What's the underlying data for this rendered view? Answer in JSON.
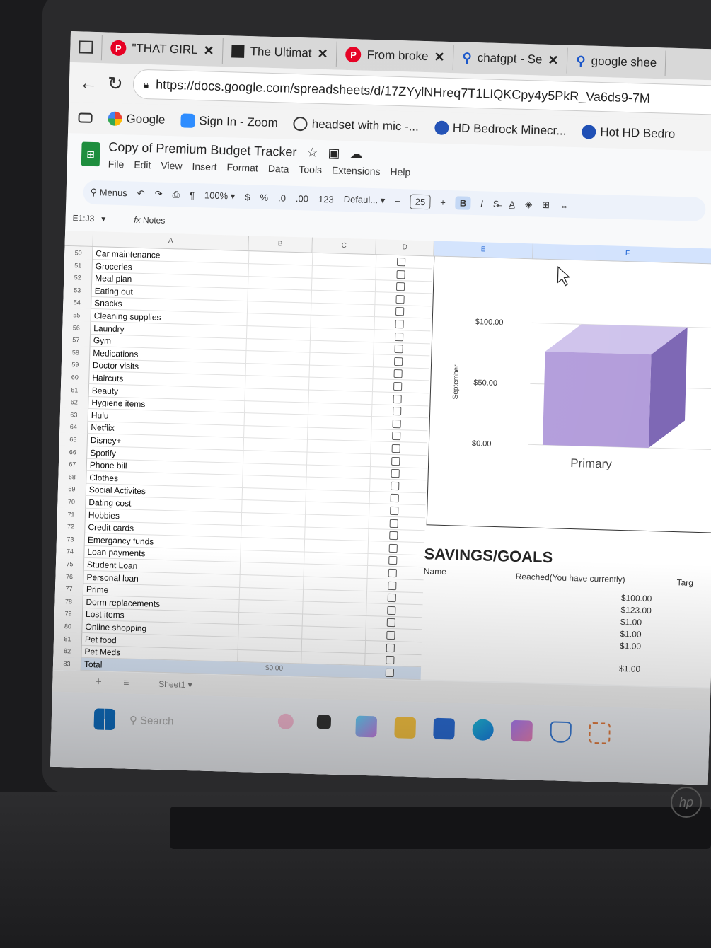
{
  "browser": {
    "tabs": [
      {
        "label": "\"THAT GIRL",
        "icon": "pinterest-icon"
      },
      {
        "label": "The Ultimat",
        "icon": "notion-icon"
      },
      {
        "label": "From broke",
        "icon": "pinterest-icon"
      },
      {
        "label": "chatgpt - Se",
        "icon": "search-icon"
      },
      {
        "label": "google shee",
        "icon": "search-icon"
      }
    ],
    "url": "https://docs.google.com/spreadsheets/d/17ZYylNHreq7T1LIQKCpy4y5PkR_Va6ds9-7M",
    "bookmarks": [
      "Google",
      "Sign In - Zoom",
      "headset with mic -...",
      "HD Bedrock Minecr...",
      "Hot HD Bedro"
    ]
  },
  "doc": {
    "title": "Copy of Premium Budget Tracker",
    "menu": [
      "File",
      "Edit",
      "View",
      "Insert",
      "Format",
      "Data",
      "Tools",
      "Extensions",
      "Help"
    ],
    "toolbar": {
      "menus": "Menus",
      "zoom": "100%",
      "currency": "$",
      "percent": "%",
      "dec_less": ".0",
      "dec_more": ".00",
      "num_format": "123",
      "font": "Defaul...",
      "font_size": "25",
      "bold": "B",
      "italic": "I"
    },
    "cell_ref": "E1:J3",
    "formula": "Notes"
  },
  "grid": {
    "columns": [
      "A",
      "B",
      "C",
      "D",
      "E",
      "F"
    ],
    "rows": [
      {
        "n": "50",
        "a": "Car maintenance"
      },
      {
        "n": "51",
        "a": "Groceries"
      },
      {
        "n": "52",
        "a": "Meal plan"
      },
      {
        "n": "53",
        "a": "Eating out"
      },
      {
        "n": "54",
        "a": "Snacks"
      },
      {
        "n": "55",
        "a": "Cleaning supplies"
      },
      {
        "n": "56",
        "a": "Laundry"
      },
      {
        "n": "57",
        "a": "Gym"
      },
      {
        "n": "58",
        "a": "Medications"
      },
      {
        "n": "59",
        "a": "Doctor visits"
      },
      {
        "n": "60",
        "a": "Haircuts"
      },
      {
        "n": "61",
        "a": "Beauty"
      },
      {
        "n": "62",
        "a": "Hygiene items"
      },
      {
        "n": "63",
        "a": "Hulu"
      },
      {
        "n": "64",
        "a": "Netflix"
      },
      {
        "n": "65",
        "a": "Disney+"
      },
      {
        "n": "66",
        "a": "Spotify"
      },
      {
        "n": "67",
        "a": "Phone bill"
      },
      {
        "n": "68",
        "a": "Clothes"
      },
      {
        "n": "69",
        "a": "Social Activites"
      },
      {
        "n": "70",
        "a": "Dating cost"
      },
      {
        "n": "71",
        "a": "Hobbies"
      },
      {
        "n": "72",
        "a": "Credit cards"
      },
      {
        "n": "73",
        "a": "Emergancy funds"
      },
      {
        "n": "74",
        "a": "Loan payments"
      },
      {
        "n": "75",
        "a": "Student Loan"
      },
      {
        "n": "76",
        "a": "Personal loan"
      },
      {
        "n": "77",
        "a": "Prime"
      },
      {
        "n": "78",
        "a": "Dorm replacements"
      },
      {
        "n": "79",
        "a": "Lost items"
      },
      {
        "n": "80",
        "a": "Online shopping"
      },
      {
        "n": "81",
        "a": "Pet food"
      },
      {
        "n": "82",
        "a": "Pet Meds"
      },
      {
        "n": "83",
        "a": "Total"
      }
    ],
    "total_b": "$0.00"
  },
  "chart_data": {
    "type": "bar",
    "categories": [
      "Primary"
    ],
    "series": [
      {
        "values": [
          100
        ]
      }
    ],
    "ylabel": "September",
    "yticks": [
      "$0.00",
      "$50.00",
      "$100.00"
    ],
    "ylim": [
      0,
      100
    ],
    "color": "#b39ddb"
  },
  "savings": {
    "title": "SAVINGS/GOALS",
    "col_name": "Name",
    "col_reached": "Reached(You have currently)",
    "col_target": "Targ",
    "values": [
      "$100.00",
      "$123.00",
      "$1.00",
      "$1.00",
      "$1.00"
    ],
    "total": "$1.00"
  },
  "sheet_tab": "Sheet1",
  "taskbar": {
    "search": "Search"
  }
}
